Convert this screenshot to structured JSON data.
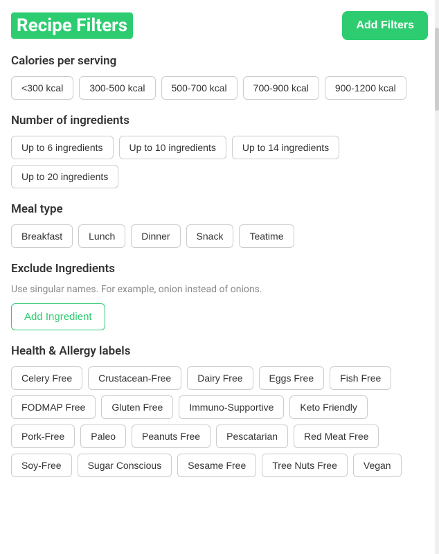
{
  "header": {
    "title": "Recipe Filters",
    "add_filters_label": "Add Filters"
  },
  "calories": {
    "section_title": "Calories per serving",
    "options": [
      "<300 kcal",
      "300-500 kcal",
      "500-700 kcal",
      "700-900 kcal",
      "900-1200 kcal"
    ]
  },
  "ingredients": {
    "section_title": "Number of ingredients",
    "options": [
      "Up to 6 ingredients",
      "Up to 10 ingredients",
      "Up to 14 ingredients",
      "Up to 20 ingredients"
    ]
  },
  "meal_type": {
    "section_title": "Meal type",
    "options": [
      "Breakfast",
      "Lunch",
      "Dinner",
      "Snack",
      "Teatime"
    ]
  },
  "exclude": {
    "section_title": "Exclude Ingredients",
    "subtitle": "Use singular names. For example, onion instead of onions.",
    "add_label": "Add Ingredient"
  },
  "health": {
    "section_title": "Health & Allergy labels",
    "options": [
      "Celery Free",
      "Crustacean-Free",
      "Dairy Free",
      "Eggs Free",
      "Fish Free",
      "FODMAP Free",
      "Gluten Free",
      "Immuno-Supportive",
      "Keto Friendly",
      "Pork-Free",
      "Paleo",
      "Peanuts Free",
      "Pescatarian",
      "Red Meat Free",
      "Soy-Free",
      "Sugar Conscious",
      "Sesame Free",
      "Tree Nuts Free",
      "Vegan"
    ]
  }
}
